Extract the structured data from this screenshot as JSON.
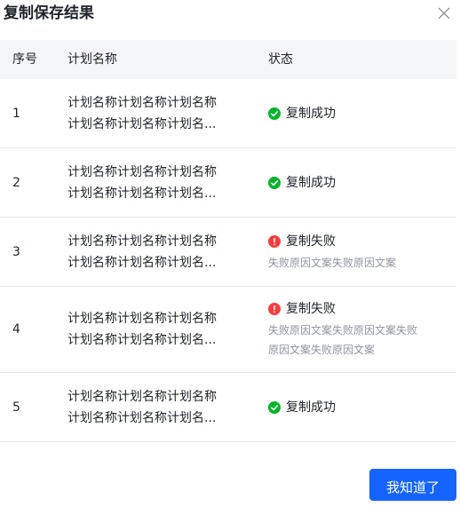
{
  "dialog": {
    "title": "复制保存结果",
    "close_icon": "close-icon"
  },
  "table": {
    "headers": {
      "index": "序号",
      "plan_name": "计划名称",
      "status": "状态"
    },
    "rows": [
      {
        "index": "1",
        "name_line1": "计划名称计划名称计划名称",
        "name_line2": "计划名称计划名称计划名...",
        "status": "复制成功",
        "status_type": "success",
        "reason_lines": []
      },
      {
        "index": "2",
        "name_line1": "计划名称计划名称计划名称",
        "name_line2": "计划名称计划名称计划名...",
        "status": "复制成功",
        "status_type": "success",
        "reason_lines": []
      },
      {
        "index": "3",
        "name_line1": "计划名称计划名称计划名称",
        "name_line2": "计划名称计划名称计划名...",
        "status": "复制失败",
        "status_type": "error",
        "reason_lines": [
          "失败原因文案失败原因文案"
        ]
      },
      {
        "index": "4",
        "name_line1": "计划名称计划名称计划名称",
        "name_line2": "计划名称计划名称计划名...",
        "status": "复制失败",
        "status_type": "error",
        "reason_lines": [
          "失败原因文案失败原因文案失败",
          "原因文案失败原因文案"
        ]
      },
      {
        "index": "5",
        "name_line1": "计划名称计划名称计划名称",
        "name_line2": "计划名称计划名称计划名...",
        "status": "复制成功",
        "status_type": "success",
        "reason_lines": []
      }
    ]
  },
  "footer": {
    "confirm_label": "我知道了"
  },
  "colors": {
    "success": "#00b42a",
    "error": "#f53f3f",
    "primary": "#1664ff"
  }
}
